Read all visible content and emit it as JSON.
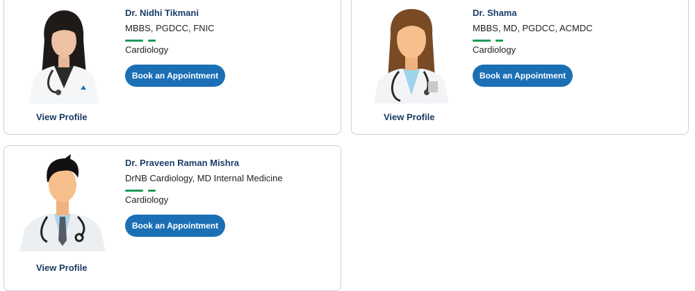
{
  "doctors": [
    {
      "name": "Dr. Nidhi Tikmani",
      "degree": "MBBS, PGDCC, FNIC",
      "specialty": "Cardiology",
      "book_label": "Book an Appointment",
      "view_profile_label": "View Profile",
      "photo": "doctor-photo-female"
    },
    {
      "name": "Dr. Shama",
      "degree": "MBBS, MD, PGDCC, ACMDC",
      "specialty": "Cardiology",
      "book_label": "Book an Appointment",
      "view_profile_label": "View Profile",
      "photo": "female-doctor-avatar"
    },
    {
      "name": "Dr. Praveen Raman Mishra",
      "degree": "DrNB Cardiology, MD Internal Medicine",
      "specialty": "Cardiology",
      "book_label": "Book an Appointment",
      "view_profile_label": "View Profile",
      "photo": "male-doctor-avatar"
    }
  ],
  "colors": {
    "name_text": "#1b3d6a",
    "button_bg": "#1b6fb5",
    "divider_green": "#1b9a57",
    "card_border": "#cfcfcf"
  }
}
